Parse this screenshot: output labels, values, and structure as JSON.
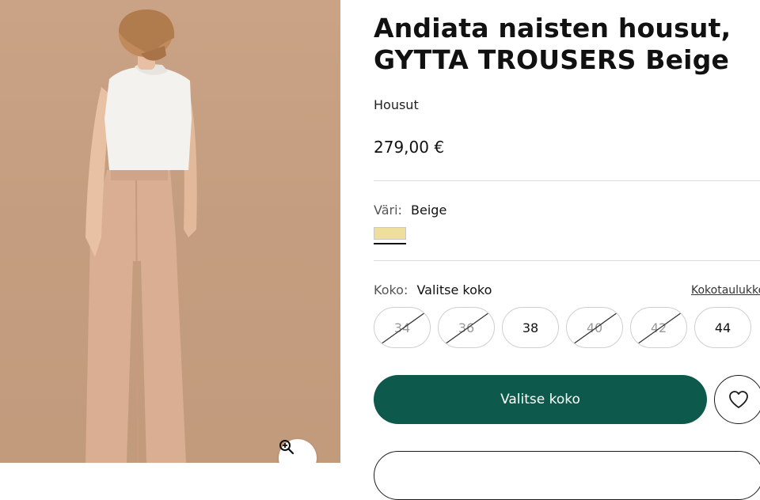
{
  "product": {
    "title": "Andiata naisten housut, GYTTA TROUSERS Beige",
    "category": "Housut",
    "price": "279,00 €"
  },
  "color": {
    "label": "Väri:",
    "selected": "Beige",
    "swatches": [
      {
        "name": "Beige",
        "hex": "#efdf9c",
        "selected": true
      }
    ]
  },
  "size": {
    "label": "Koko:",
    "selected": "Valitse koko",
    "size_chart_link": "Kokotaulukko",
    "options": [
      {
        "label": "34",
        "available": false
      },
      {
        "label": "36",
        "available": false
      },
      {
        "label": "38",
        "available": true
      },
      {
        "label": "40",
        "available": false
      },
      {
        "label": "42",
        "available": false
      },
      {
        "label": "44",
        "available": true
      }
    ]
  },
  "actions": {
    "add_to_cart_label": "Valitse koko",
    "wishlist_icon": "heart-icon",
    "zoom_icon": "zoom-in-icon"
  },
  "colors": {
    "primary_button": "#0d5a4c",
    "background": "#ffffff"
  }
}
